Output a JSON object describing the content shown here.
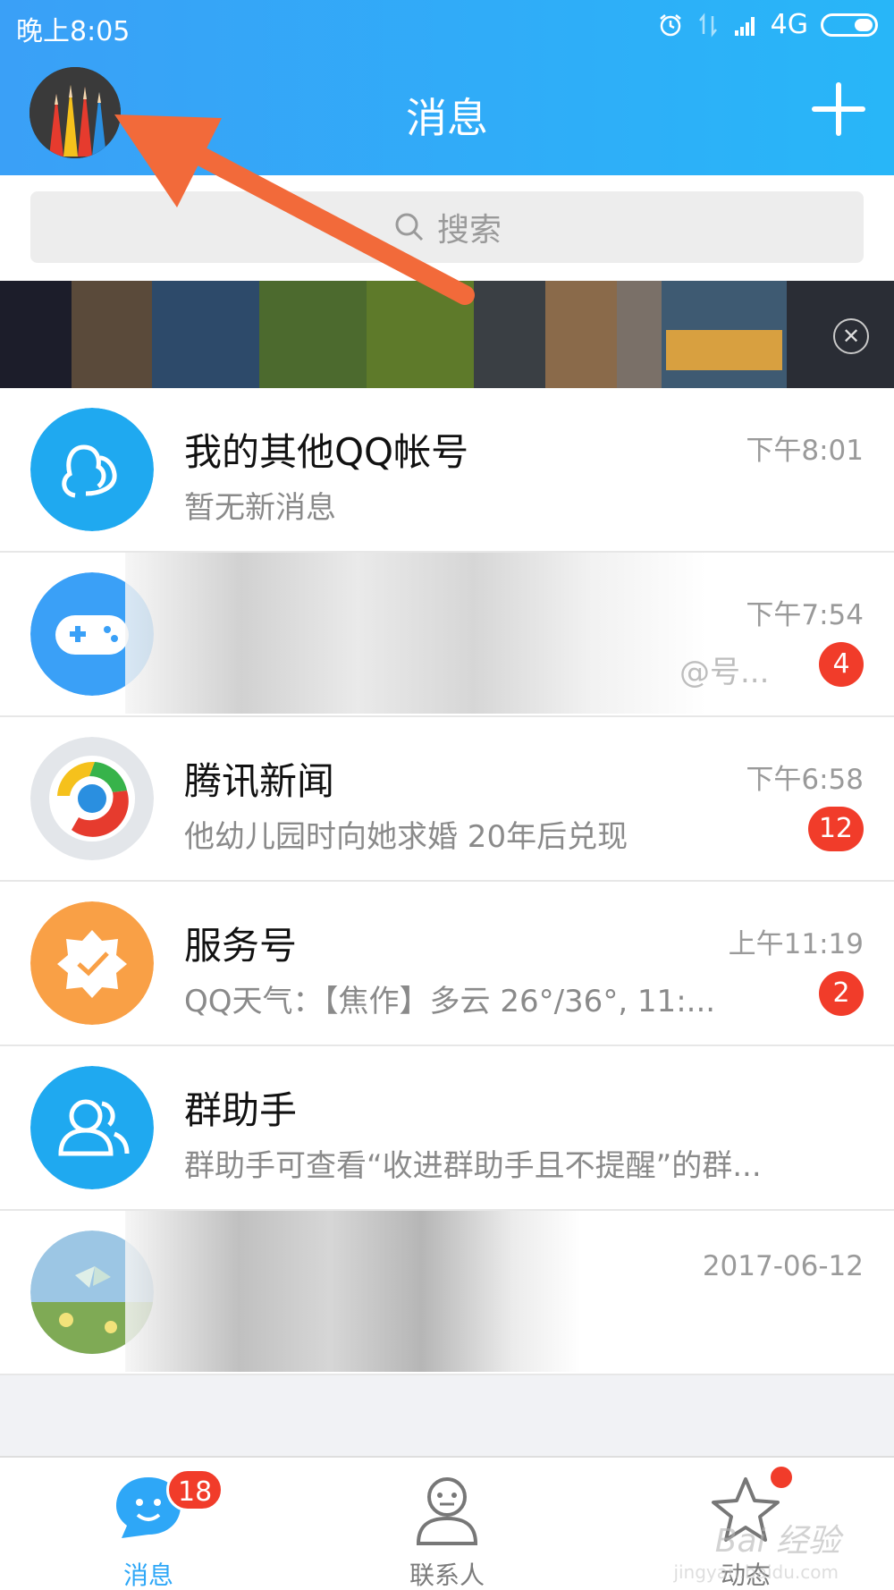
{
  "status_bar": {
    "time": "晚上8:05",
    "network": "4G"
  },
  "header": {
    "title": "消息",
    "add_icon": "plus-icon"
  },
  "search": {
    "placeholder": "搜索"
  },
  "conversations": [
    {
      "name": "我的其他QQ帐号",
      "preview": "暂无新消息",
      "time": "下午8:01",
      "badge": ""
    },
    {
      "name": "",
      "preview": "@号...",
      "time": "下午7:54",
      "badge": "4"
    },
    {
      "name": "腾讯新闻",
      "preview": "他幼儿园时向她求婚 20年后兑现",
      "time": "下午6:58",
      "badge": "12"
    },
    {
      "name": "服务号",
      "preview": "QQ天气：【焦作】多云 26°/36°, 11:...",
      "time": "上午11:19",
      "badge": "2"
    },
    {
      "name": "群助手",
      "preview": "群助手可查看“收进群助手且不提醒”的群...",
      "time": "",
      "badge": ""
    },
    {
      "name": "",
      "preview": "",
      "time": "2017-06-12",
      "badge": ""
    }
  ],
  "tabs": [
    {
      "label": "消息",
      "badge": "18",
      "icon": "smile-bubble-icon"
    },
    {
      "label": "联系人",
      "icon": "person-icon"
    },
    {
      "label": "动态",
      "icon": "star-icon"
    }
  ],
  "watermark": {
    "text": "Bai 经验",
    "sub": "jingyan.baidu.com"
  },
  "colors": {
    "header": "#2ea7f7",
    "badge": "#f13c2a",
    "annotation_arrow": "#f26a3a"
  }
}
